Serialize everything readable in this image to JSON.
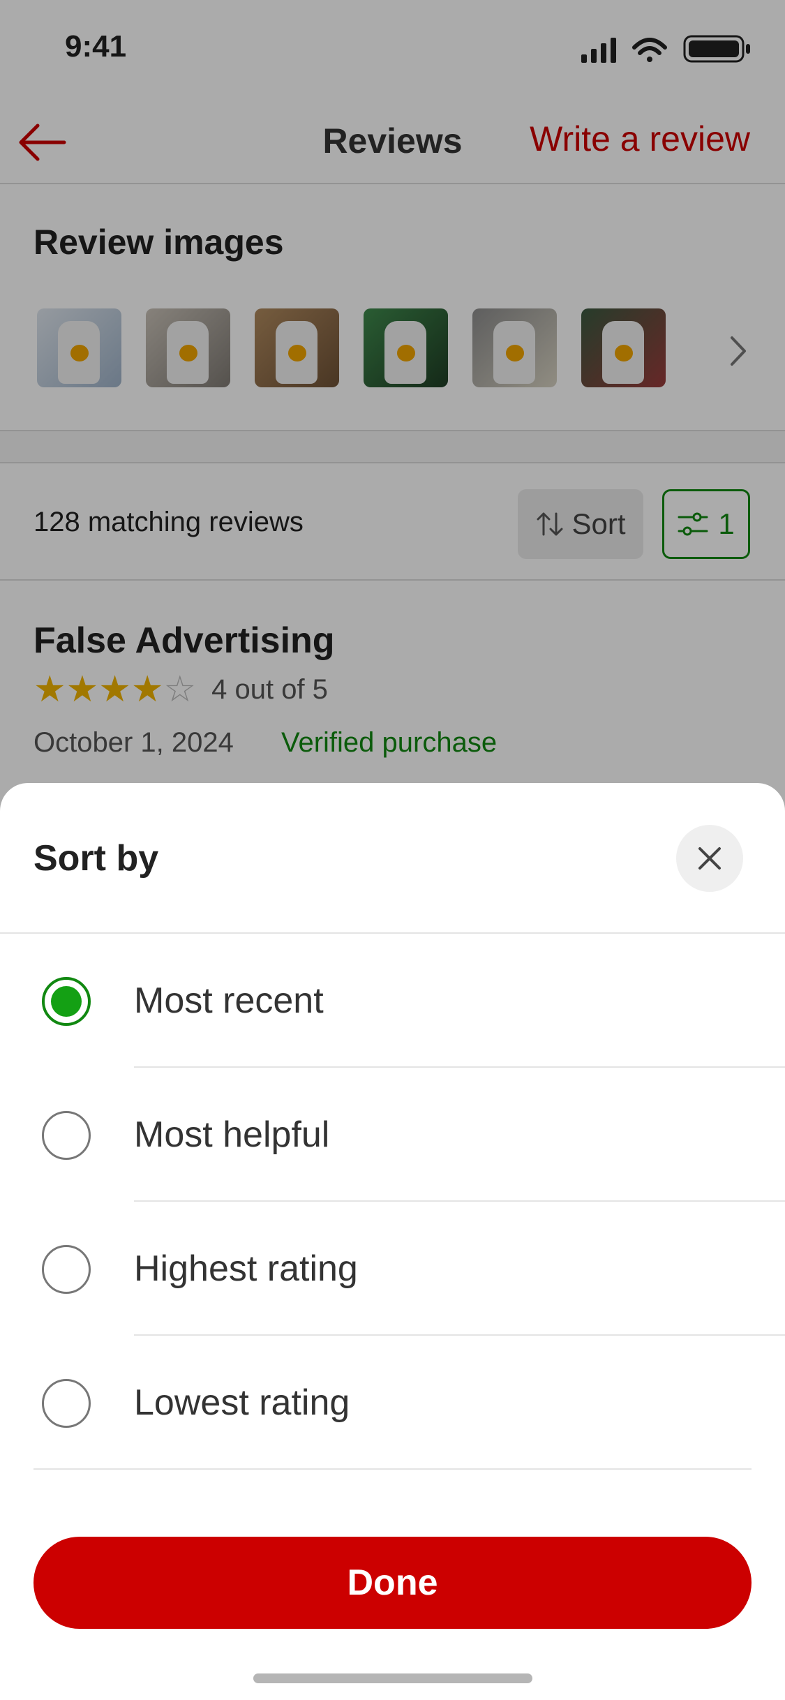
{
  "status_bar": {
    "time": "9:41"
  },
  "nav": {
    "title": "Reviews",
    "write_review": "Write a review"
  },
  "review_images": {
    "title": "Review images",
    "thumbnail_count": 6
  },
  "filters": {
    "matching_count": "128 matching reviews",
    "sort_label": "Sort",
    "filter_count": "1"
  },
  "review": {
    "title": "False Advertising",
    "rating": 4,
    "rating_max": 5,
    "rating_text": "4 out of 5",
    "date": "October 1, 2024",
    "verified": "Verified purchase"
  },
  "sheet": {
    "title": "Sort by",
    "options": [
      {
        "label": "Most recent",
        "selected": true
      },
      {
        "label": "Most helpful",
        "selected": false
      },
      {
        "label": "Highest rating",
        "selected": false
      },
      {
        "label": "Lowest rating",
        "selected": false
      }
    ],
    "done_label": "Done"
  },
  "colors": {
    "brand_red": "#cc0000",
    "verified_green": "#118811",
    "star_gold": "#f0b400"
  },
  "icons": [
    "back-arrow-icon",
    "chevron-right-icon",
    "sort-arrows-icon",
    "filter-sliders-icon",
    "close-icon",
    "star-icon",
    "signal-icon",
    "wifi-icon",
    "battery-icon"
  ]
}
